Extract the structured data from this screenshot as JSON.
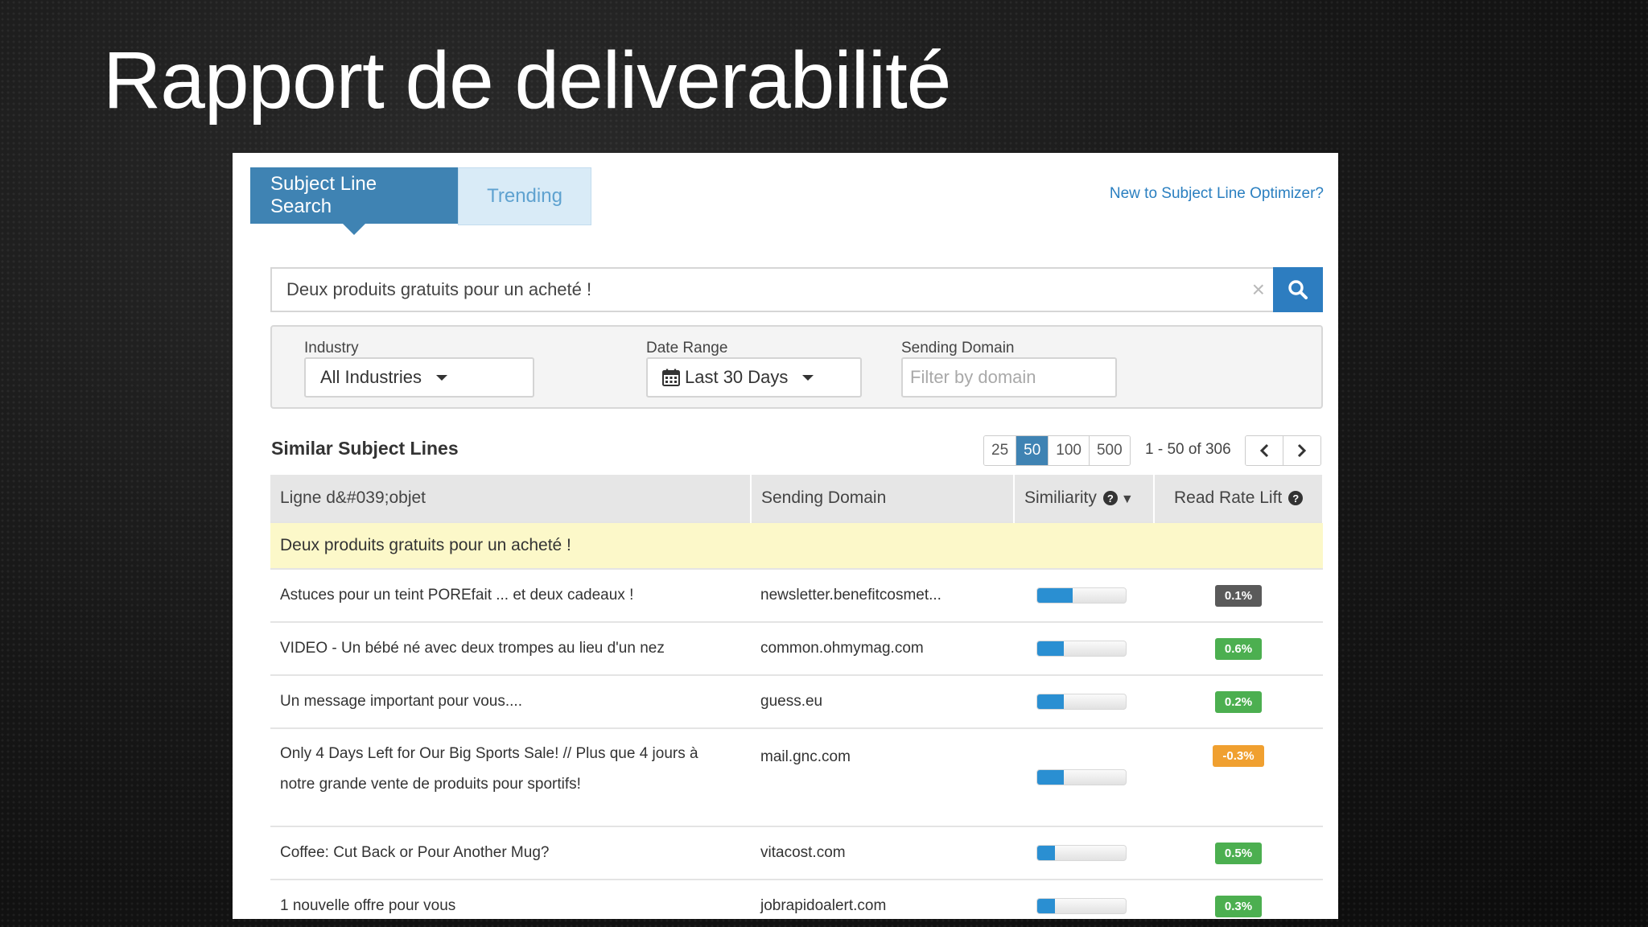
{
  "slide": {
    "title": "Rapport de deliverabilité"
  },
  "tabs": [
    {
      "label": "Subject Line Search",
      "active": true
    },
    {
      "label": "Trending",
      "active": false
    }
  ],
  "help_link": "New to Subject Line Optimizer?",
  "search": {
    "value": "Deux produits gratuits pour un acheté !",
    "clear_icon": "×"
  },
  "filters": {
    "industry": {
      "label": "Industry",
      "value": "All Industries"
    },
    "date_range": {
      "label": "Date Range",
      "value": "Last 30 Days"
    },
    "sending_domain": {
      "label": "Sending Domain",
      "placeholder": "Filter by domain"
    }
  },
  "results": {
    "title": "Similar Subject Lines",
    "page_sizes": [
      "25",
      "50",
      "100",
      "500"
    ],
    "active_page_size": "50",
    "range_text": "1 - 50 of 306",
    "prev_icon": "‹",
    "next_icon": "›"
  },
  "table": {
    "headers": {
      "subject": "Ligne d&#039;objet",
      "domain": "Sending Domain",
      "similarity": "Similiarity",
      "read_rate_lift": "Read Rate Lift"
    },
    "query_row": {
      "subject": "Deux produits gratuits pour un acheté !"
    },
    "rows": [
      {
        "subject": "Astuces pour un teint POREfait ... et deux cadeaux !",
        "domain": "newsletter.benefitcosmet...",
        "similarity": 0.4,
        "lift": "0.1%",
        "lift_color": "#5a5a5a"
      },
      {
        "subject": "VIDEO - Un bébé né avec deux trompes au lieu d'un nez",
        "domain": "common.ohmymag.com",
        "similarity": 0.3,
        "lift": "0.6%",
        "lift_color": "#4caf50"
      },
      {
        "subject": "Un message important pour vous....",
        "domain": "guess.eu",
        "similarity": 0.3,
        "lift": "0.2%",
        "lift_color": "#4caf50"
      },
      {
        "subject_line1": "Only 4 Days Left for Our Big Sports Sale! // Plus que 4 jours à",
        "subject_line2": "notre grande vente de produits pour sportifs!",
        "domain": "mail.gnc.com",
        "similarity": 0.3,
        "lift": "-0.3%",
        "lift_color": "#f0a030"
      },
      {
        "subject": "Coffee: Cut Back or Pour Another Mug?",
        "domain": "vitacost.com",
        "similarity": 0.2,
        "lift": "0.5%",
        "lift_color": "#4caf50"
      },
      {
        "subject": "1 nouvelle offre pour vous",
        "domain": "jobrapidoalert.com",
        "similarity": 0.2,
        "lift": "0.3%",
        "lift_color": "#4caf50"
      }
    ]
  }
}
